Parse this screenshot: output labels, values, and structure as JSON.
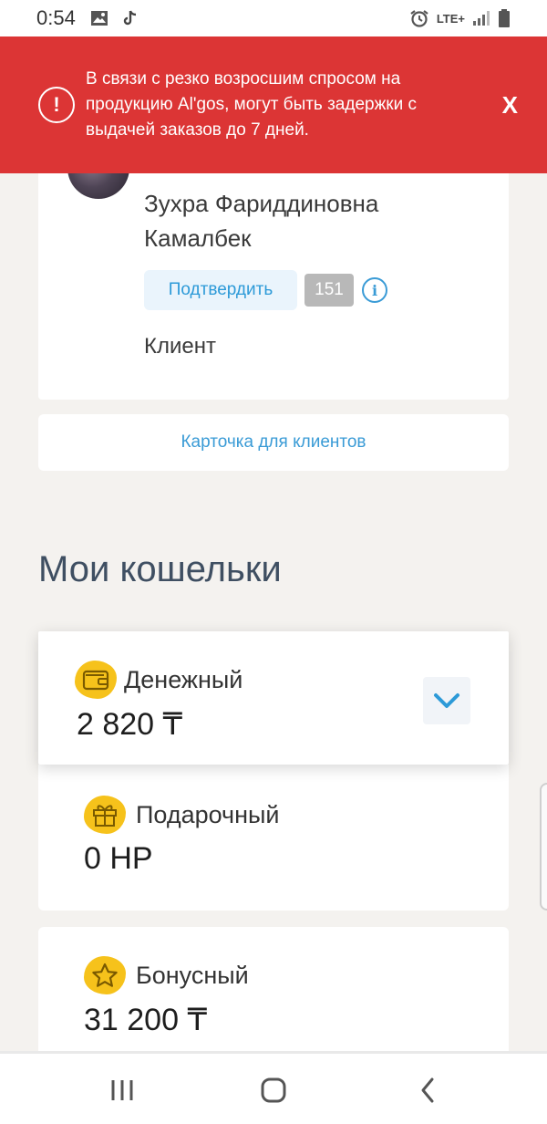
{
  "status_bar": {
    "time": "0:54",
    "network": "LTE+"
  },
  "banner": {
    "message": "В связи с резко возросшим спросом на продукцию Al'gos, могут быть задержки с выдачей заказов до 7 дней.",
    "close_label": "X",
    "alert_glyph": "!"
  },
  "profile": {
    "name": "Зухра Фариддиновна Камалбек",
    "confirm_label": "Подтвердить",
    "badge_count": "151",
    "info_glyph": "i",
    "role": "Клиент"
  },
  "client_card_button": "Карточка для клиентов",
  "wallets_section": {
    "title": "Мои кошельки",
    "items": [
      {
        "name": "Денежный",
        "amount": "2 820 ₸",
        "icon": "wallet-icon",
        "expanded_control": "chevron-down-icon"
      },
      {
        "name": "Подарочный",
        "amount": "0 НР",
        "icon": "gift-icon"
      },
      {
        "name": "Бонусный",
        "amount": "31 200 ₸",
        "icon": "star-icon"
      }
    ]
  },
  "colors": {
    "banner": "#dc3535",
    "accent": "#3a9bd6",
    "wallet_icon_bg": "#f6c21b",
    "title": "#3f4f62"
  }
}
